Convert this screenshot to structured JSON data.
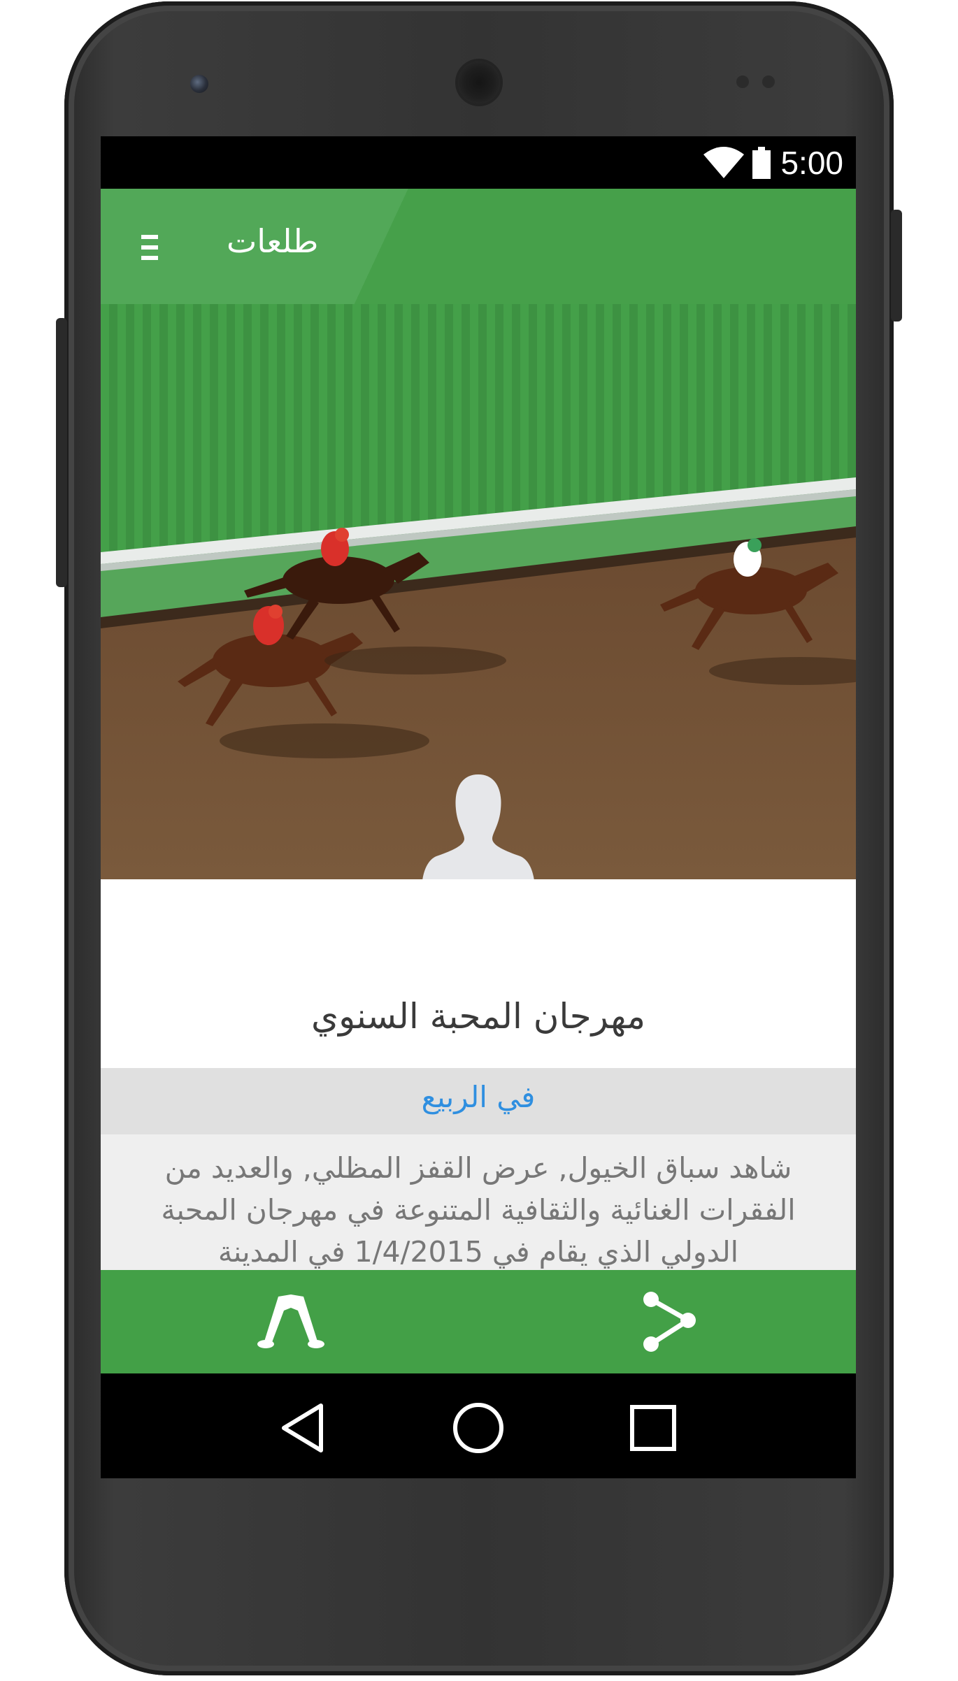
{
  "status_bar": {
    "time": "5:00",
    "icons": [
      "wifi-icon",
      "battery-icon"
    ]
  },
  "app_bar": {
    "title": "طلعات",
    "menu_icon": "menu-icon"
  },
  "event": {
    "title": "مهرجان المحبة السنوي",
    "season": "في الربيع",
    "description": "شاهد سباق الخيول, عرض القفز المظلي, والعديد من الفقرات الغنائية والثقافية المتنوعة في مهرجان المحبة الدولي الذي يقام في 1/4/2015 في المدينة"
  },
  "bottom_actions": {
    "bookmark_icon": "bookmark-icon",
    "share_icon": "share-icon"
  },
  "nav": {
    "back_icon": "back-icon",
    "home_icon": "home-icon",
    "recent_icon": "recent-apps-icon"
  },
  "colors": {
    "primary": "#43a047",
    "primary_light": "#52a858",
    "link": "#2f8fe0",
    "season_band": "#e0e0e0",
    "description_band": "#efefef"
  }
}
